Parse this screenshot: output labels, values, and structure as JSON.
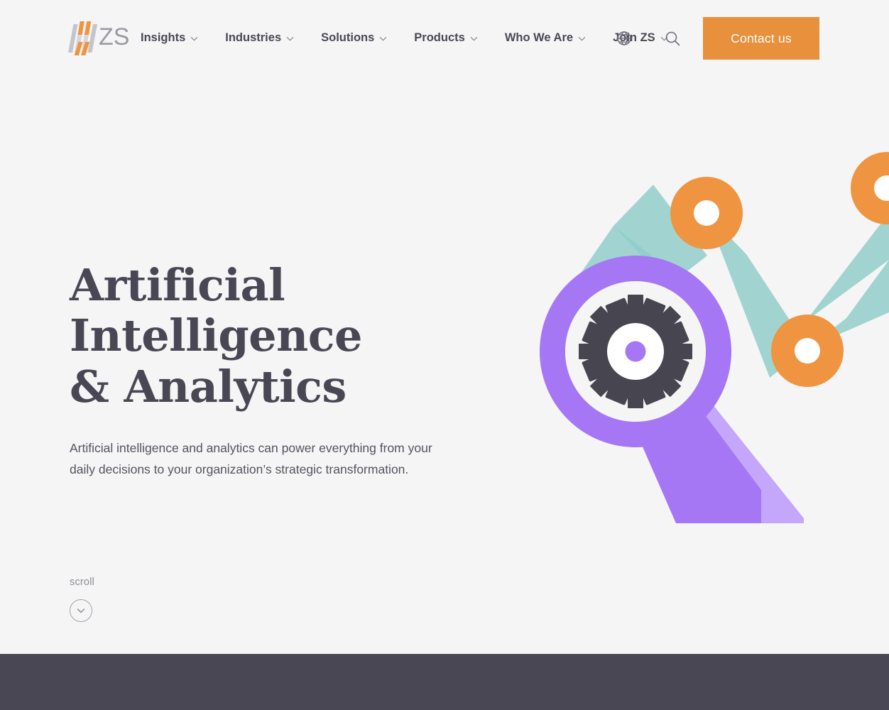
{
  "site": {
    "brand_name": "ZS",
    "logo_icon": "zs-logo-bars-icon",
    "background_color": "#f5f5f5",
    "accent_color": "#e8903c",
    "ink_color": "#4a4755"
  },
  "header": {
    "nav_items": [
      {
        "label": "Insights",
        "icon": "chevron-down-icon"
      },
      {
        "label": "Industries",
        "icon": "chevron-down-icon"
      },
      {
        "label": "Solutions",
        "icon": "chevron-down-icon"
      },
      {
        "label": "Products",
        "icon": "chevron-down-icon"
      },
      {
        "label": "Who We Are",
        "icon": "chevron-down-icon"
      },
      {
        "label": "Join ZS",
        "icon": "chevron-down-icon"
      }
    ],
    "language_icon": "globe-icon",
    "search_icon": "search-icon",
    "contact_button_label": "Contact us"
  },
  "hero": {
    "title_line_1": "Artificial Intelligence",
    "title_line_2": "& Analytics",
    "subtitle": "Artificial intelligence and analytics can power everything from your daily decisions to your organization’s strategic transformation.",
    "graphic": {
      "name": "magnifier-gear-zigzag-illustration",
      "magnifier_ring_color": "#a577f5",
      "magnifier_handle_shadow_color": "#c4a6fa",
      "gear_color": "#47454f",
      "gear_hub_color": "#a577f5",
      "zigzag_color": "#8fcdc8",
      "node_color": "#ef9440",
      "node_inner_color": "#ffffff"
    }
  },
  "scroll_cue": {
    "label": "scroll",
    "icon": "chevron-down-circle-icon"
  },
  "footer": {
    "band_color": "#4a4755"
  }
}
